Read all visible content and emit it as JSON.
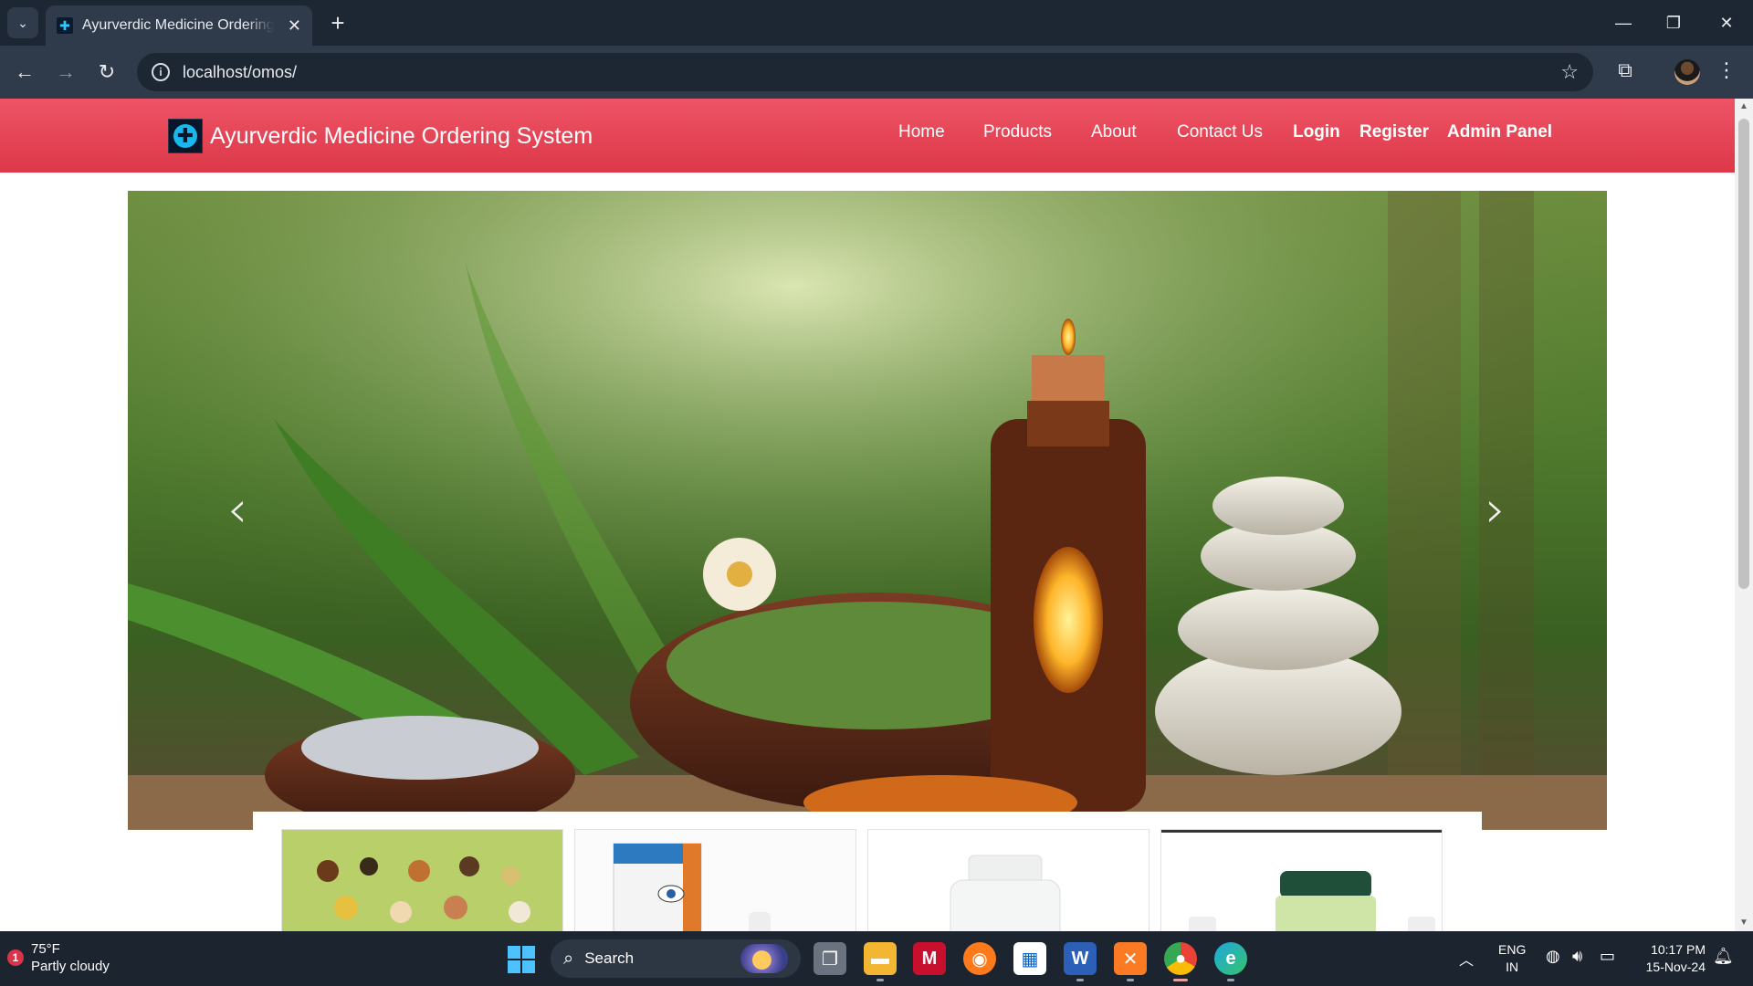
{
  "browser": {
    "tab_title": "Ayurverdic Medicine Ordering System",
    "url": "localhost/omos/",
    "new_tab_symbol": "+",
    "close_symbol": "✕"
  },
  "site": {
    "brand": "Ayurverdic Medicine Ordering System",
    "nav": {
      "home": "Home",
      "products": "Products",
      "about": "About",
      "contact": "Contact Us",
      "login": "Login",
      "register": "Register",
      "admin": "Admin Panel"
    },
    "carousel": {
      "prev_symbol": "‹",
      "next_symbol": "›"
    },
    "colors": {
      "navbar": "#e5414f",
      "navbar_text": "#ffffff"
    }
  },
  "taskbar": {
    "weather_badge": "1",
    "temperature": "75°F",
    "condition": "Partly cloudy",
    "search_label": "Search",
    "lang_line1": "ENG",
    "lang_line2": "IN",
    "time": "10:17 PM",
    "date": "15-Nov-24"
  }
}
